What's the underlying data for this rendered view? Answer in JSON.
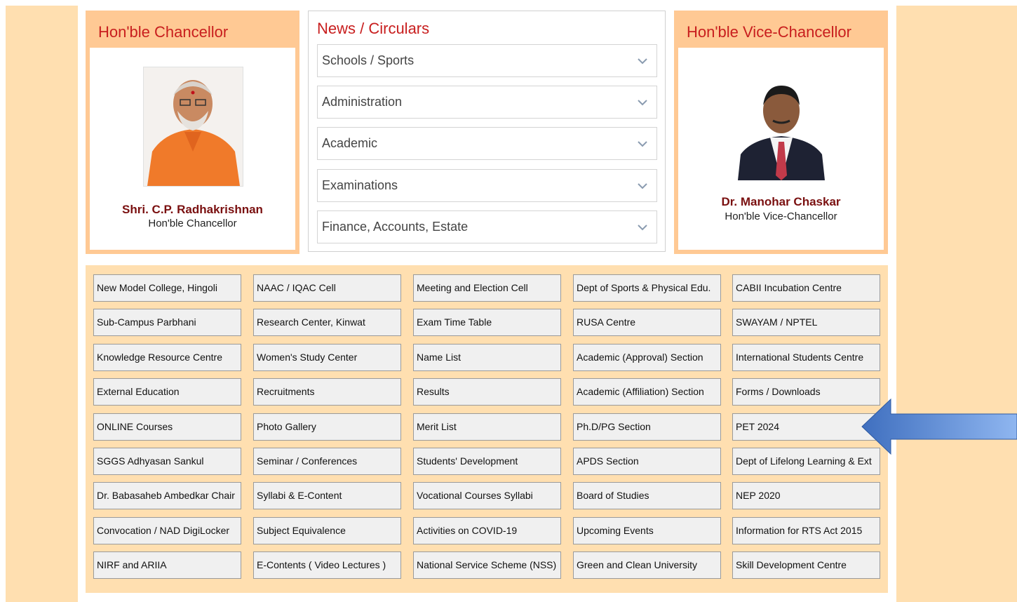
{
  "chancellor": {
    "title": "Hon'ble Chancellor",
    "name": "Shri. C.P. Radhakrishnan",
    "role": "Hon'ble Chancellor"
  },
  "news": {
    "title": "News / Circulars",
    "sections": [
      "Schools / Sports",
      "Administration",
      "Academic",
      "Examinations",
      "Finance, Accounts, Estate"
    ]
  },
  "vice_chancellor": {
    "title": "Hon'ble Vice-Chancellor",
    "name": "Dr. Manohar Chaskar",
    "role": "Hon'ble Vice-Chancellor"
  },
  "links": [
    [
      "New Model College, Hingoli",
      "NAAC / IQAC Cell",
      "Meeting and Election Cell",
      "Dept of Sports & Physical Edu.",
      "CABII Incubation Centre"
    ],
    [
      "Sub-Campus Parbhani",
      "Research Center, Kinwat",
      "Exam Time Table",
      "RUSA Centre",
      "SWAYAM / NPTEL"
    ],
    [
      "Knowledge Resource Centre",
      "Women's Study Center",
      "Name List",
      "Academic (Approval) Section",
      "International Students Centre"
    ],
    [
      "External Education",
      "Recruitments",
      "Results",
      "Academic (Affiliation) Section",
      "Forms / Downloads"
    ],
    [
      "ONLINE Courses",
      "Photo Gallery",
      "Merit List",
      "Ph.D/PG Section",
      "PET 2024"
    ],
    [
      "SGGS Adhyasan Sankul",
      "Seminar / Conferences",
      "Students' Development",
      "APDS Section",
      "Dept of Lifelong Learning & Ext"
    ],
    [
      "Dr. Babasaheb Ambedkar Chair",
      "Syllabi & E-Content",
      "Vocational Courses Syllabi",
      "Board of Studies",
      "NEP 2020"
    ],
    [
      "Convocation / NAD DigiLocker",
      "Subject Equivalence",
      "Activities on COVID-19",
      "Upcoming Events",
      "Information for RTS Act 2015"
    ],
    [
      "NIRF and ARIIA",
      "E-Contents ( Video Lectures )",
      "National Service Scheme (NSS)",
      "Green and Clean University",
      "Skill Development Centre"
    ]
  ],
  "colors": {
    "accent_red": "#c81e1e",
    "panel_orange": "#ffc994",
    "page_cream": "#ffdfb0",
    "arrow_blue": "#4a80c8"
  }
}
